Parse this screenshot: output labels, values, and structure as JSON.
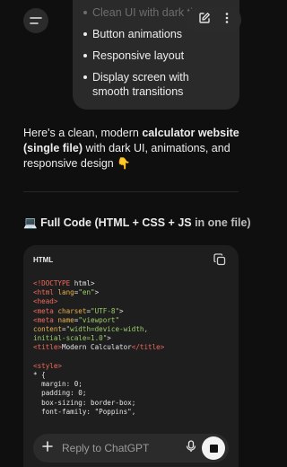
{
  "bullets": {
    "items": [
      {
        "label": "Clean UI with dark theme"
      },
      {
        "label": "Button animations"
      },
      {
        "label": "Responsive layout"
      },
      {
        "label": "Display screen with smooth transitions"
      }
    ]
  },
  "reply": {
    "text_1": "Here's a clean, modern ",
    "bold": "calculator website (single file)",
    "text_2": " with dark UI, animations, and responsive design ",
    "emoji": "👇"
  },
  "heading": {
    "emoji": "💻",
    "text_bold": "Full Code (HTML + CSS + JS",
    "text_dim": " in one file)"
  },
  "code_block": {
    "language": "HTML"
  },
  "composer": {
    "placeholder": "Reply to ChatGPT"
  },
  "icons": {
    "menu": "menu-icon",
    "edit": "edit-icon",
    "more": "more-vertical-icon",
    "copy": "copy-icon",
    "plus": "plus-icon",
    "mic": "microphone-icon",
    "stop": "stop-icon"
  }
}
